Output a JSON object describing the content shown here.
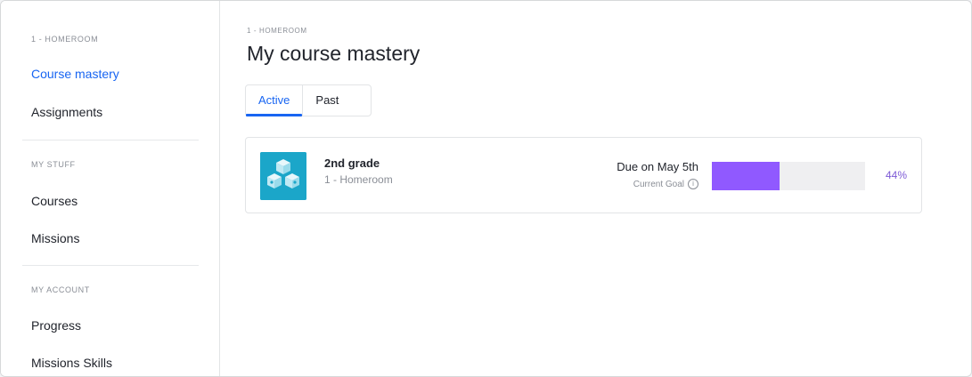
{
  "sidebar": {
    "class_label": "1 - HOMEROOM",
    "class_items": [
      {
        "label": "Course mastery",
        "active": true
      },
      {
        "label": "Assignments",
        "active": false
      }
    ],
    "my_stuff_label": "MY STUFF",
    "my_stuff_items": [
      {
        "label": "Courses"
      },
      {
        "label": "Missions"
      }
    ],
    "my_account_label": "MY ACCOUNT",
    "my_account_items": [
      {
        "label": "Progress"
      },
      {
        "label": "Missions Skills"
      }
    ]
  },
  "main": {
    "breadcrumb": "1 - HOMEROOM",
    "title": "My course mastery",
    "tabs": [
      {
        "label": "Active",
        "active": true
      },
      {
        "label": "Past",
        "active": false
      }
    ],
    "course": {
      "name": "2nd grade",
      "class_name": "1 - Homeroom",
      "due": "Due on May 5th",
      "goal_label": "Current Goal",
      "progress_fraction": 0.44,
      "progress_label": "44%",
      "icon": "course-blocks-icon"
    }
  },
  "colors": {
    "accent": "#1865f2",
    "progress_fill": "#9059ff",
    "progress_track": "#efeff1",
    "course_thumb": "#1ba6c9"
  }
}
